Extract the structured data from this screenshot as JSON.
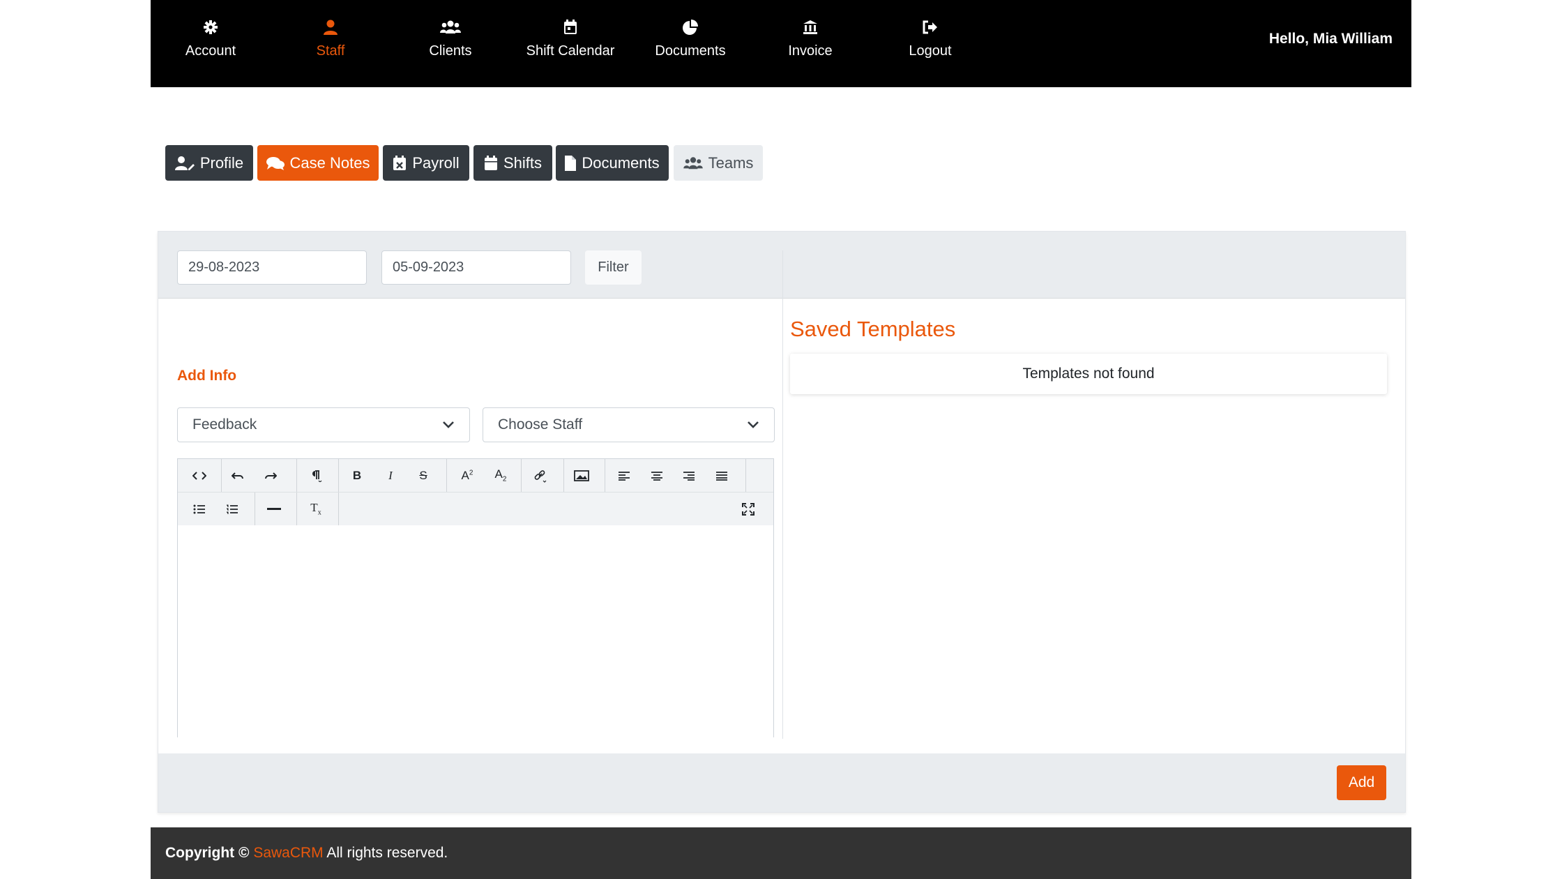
{
  "nav": {
    "items": [
      {
        "label": "Account",
        "icon": "gear-icon"
      },
      {
        "label": "Staff",
        "icon": "user-icon"
      },
      {
        "label": "Clients",
        "icon": "users-icon"
      },
      {
        "label": "Shift Calendar",
        "icon": "calendar-icon"
      },
      {
        "label": "Documents",
        "icon": "pie-chart-icon"
      },
      {
        "label": "Invoice",
        "icon": "bank-icon"
      },
      {
        "label": "Logout",
        "icon": "sign-out-icon"
      }
    ],
    "active": "Staff",
    "greeting": "Hello, Mia William"
  },
  "tabs": [
    {
      "label": "Profile",
      "icon": "user-edit-icon"
    },
    {
      "label": "Case Notes",
      "icon": "comments-icon"
    },
    {
      "label": "Payroll",
      "icon": "calendar-x-icon"
    },
    {
      "label": "Shifts",
      "icon": "calendar-icon"
    },
    {
      "label": "Documents",
      "icon": "file-icon"
    },
    {
      "label": "Teams",
      "icon": "users-icon"
    }
  ],
  "active_tab": "Case Notes",
  "filter": {
    "date_from": "29-08-2023",
    "date_to": "05-09-2023",
    "button_label": "Filter"
  },
  "add_info": {
    "title": "Add Info",
    "type_select": "Feedback",
    "staff_select": "Choose Staff"
  },
  "saved_templates": {
    "title": "Saved Templates",
    "empty_message": "Templates not found"
  },
  "footer_actions": {
    "add_label": "Add"
  },
  "footer": {
    "copyright_prefix": "Copyright ©",
    "brand": "SawaCRM",
    "suffix": "All rights reserved."
  },
  "colors": {
    "accent": "#ea580c",
    "dark": "#343a40",
    "nav_bg": "#000000",
    "footer_bg": "#333333"
  }
}
